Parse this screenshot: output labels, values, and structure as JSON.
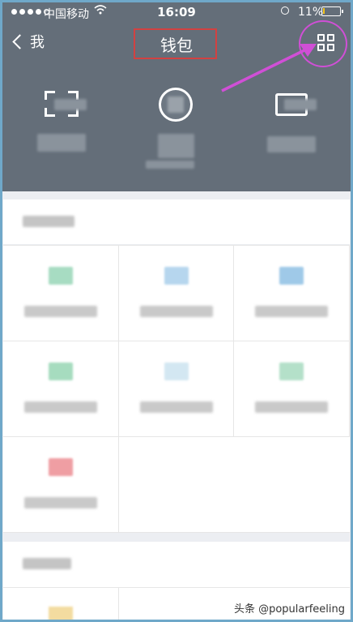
{
  "status_bar": {
    "carrier": "中国移动",
    "time": "16:09",
    "battery": "11%",
    "battery_level": 0.11,
    "icons": [
      "signal-dots-icon",
      "wifi-icon",
      "orientation-lock-icon",
      "battery-icon"
    ]
  },
  "nav": {
    "back_label": "我",
    "title": "钱包",
    "menu_icon": "grid-icon"
  },
  "annotation": {
    "arrow_color": "#d04fd6",
    "title_box_color": "#d24141"
  },
  "hero": {
    "background": "#646e79",
    "items": [
      {
        "icon": "scan-icon"
      },
      {
        "icon": "pay-icon"
      },
      {
        "icon": "card-icon"
      }
    ]
  },
  "grid": {
    "cells": [
      {
        "icon": "green-icon",
        "color": "#a7dcc2"
      },
      {
        "icon": "blue-icon",
        "color": "#b6d6ee"
      },
      {
        "icon": "blue-icon",
        "color": "#9fc9e8"
      },
      {
        "icon": "green-icon",
        "color": "#a6dcbf"
      },
      {
        "icon": "light-blue-icon",
        "color": "#d3e7f2"
      },
      {
        "icon": "green-icon",
        "color": "#b4e0c9"
      },
      {
        "icon": "red-icon",
        "color": "#ef9ea3"
      }
    ]
  },
  "watermark": "头条 @popularfeeling"
}
